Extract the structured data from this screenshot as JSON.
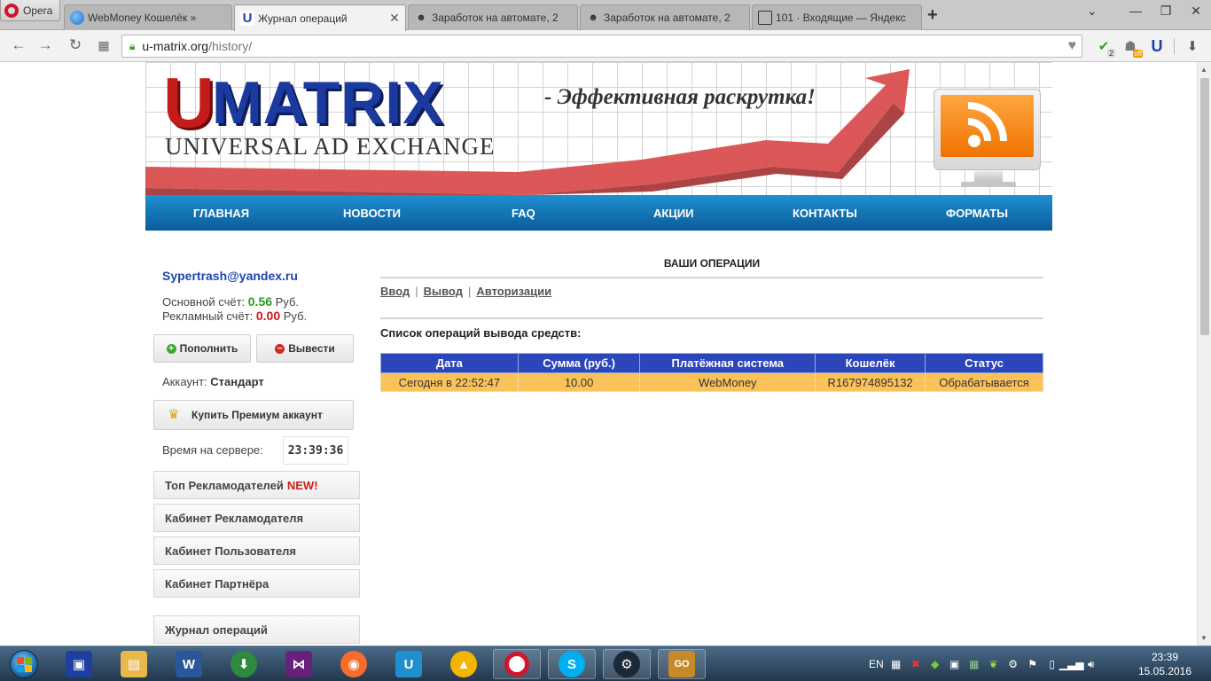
{
  "browser": {
    "menu_label": "Opera",
    "tabs": [
      {
        "title": "WebMoney Кошелёк »"
      },
      {
        "title": "Журнал операций"
      },
      {
        "title": "Заработок на автомате, 2"
      },
      {
        "title": "Заработок на автомате, 2"
      },
      {
        "title": "101 · Входящие — Яндекс"
      }
    ],
    "new_tab": "+",
    "url_host": "u-matrix.org",
    "url_path": "/history/",
    "extension_badge_count": "2",
    "extension_off_label": "off"
  },
  "site": {
    "logo_u": "U",
    "logo_matrix": "MATRIX",
    "logo_sub": "UNIVERSAL AD EXCHANGE",
    "slogan": "- Эффективная раскрутка!",
    "menu": [
      "ГЛАВНАЯ",
      "НОВОСТИ",
      "FAQ",
      "АКЦИИ",
      "КОНТАКТЫ",
      "ФОРМАТЫ"
    ]
  },
  "sidebar": {
    "email": "Sypertrash@yandex.ru",
    "main_balance_label": "Основной счёт:",
    "main_balance_value": "0.56",
    "ad_balance_label": "Рекламный счёт:",
    "ad_balance_value": "0.00",
    "currency": "Руб.",
    "deposit_button": "Пополнить",
    "withdraw_button": "Вывести",
    "account_label": "Аккаунт:",
    "account_type": "Стандарт",
    "premium_button": "Купить Премиум аккаунт",
    "server_time_label": "Время на сервере:",
    "server_time": "23:39:36",
    "links": [
      {
        "label": "Топ Рекламодателей",
        "badge": "NEW!"
      },
      {
        "label": "Кабинет Рекламодателя"
      },
      {
        "label": "Кабинет Пользователя"
      },
      {
        "label": "Кабинет Партнёра"
      },
      {
        "label": "Журнал операций"
      }
    ]
  },
  "main": {
    "title": "ВАШИ ОПЕРАЦИИ",
    "filters": [
      "Ввод",
      "Вывод",
      "Авторизации"
    ],
    "list_title": "Список операций вывода средств:",
    "table": {
      "headers": [
        "Дата",
        "Сумма (руб.)",
        "Платёжная система",
        "Кошелёк",
        "Статус"
      ],
      "rows": [
        [
          "Сегодня в 22:52:47",
          "10.00",
          "WebMoney",
          "R167974895132",
          "Обрабатывается"
        ]
      ]
    }
  },
  "taskbar": {
    "lang": "EN",
    "time": "23:39",
    "date": "15.05.2016"
  },
  "colors": {
    "menu_blue": "#0a5c9a",
    "table_header": "#2b46b8",
    "table_row": "#fbc25a",
    "positive": "#2c9a20",
    "negative": "#cc1515"
  }
}
